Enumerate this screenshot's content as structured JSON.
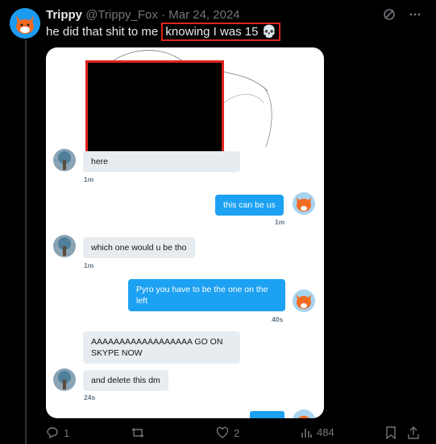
{
  "tweet": {
    "display_name": "Trippy",
    "handle": "@Trippy_Fox",
    "separator": "·",
    "date": "Mar 24, 2024",
    "text_before": "he did that shit to me ",
    "text_highlight": "knowing I was 15",
    "emoji": "💀"
  },
  "dm": {
    "messages": [
      {
        "side": "in",
        "text": "here",
        "time": "1m"
      },
      {
        "side": "out",
        "text": "this can be us",
        "time": "1m"
      },
      {
        "side": "in",
        "text": "which one would u be tho",
        "time": "1m"
      },
      {
        "side": "out",
        "text": "Pyro you have to be the one on the left",
        "time": "40s"
      },
      {
        "side": "in",
        "text": "AAAAAAAAAAAAAAAAAA GO ON SKYPE NOW",
        "time": ""
      },
      {
        "side": "in",
        "text": "and delete this dm",
        "time": "24s"
      }
    ]
  },
  "actions": {
    "replies": "1",
    "reposts": "",
    "likes": "2",
    "views": "484"
  },
  "colors": {
    "accent": "#1d9bf0",
    "highlight_border": "#e0241f",
    "dm_out": "#1da1f2",
    "dm_in": "#e6ecf0"
  }
}
